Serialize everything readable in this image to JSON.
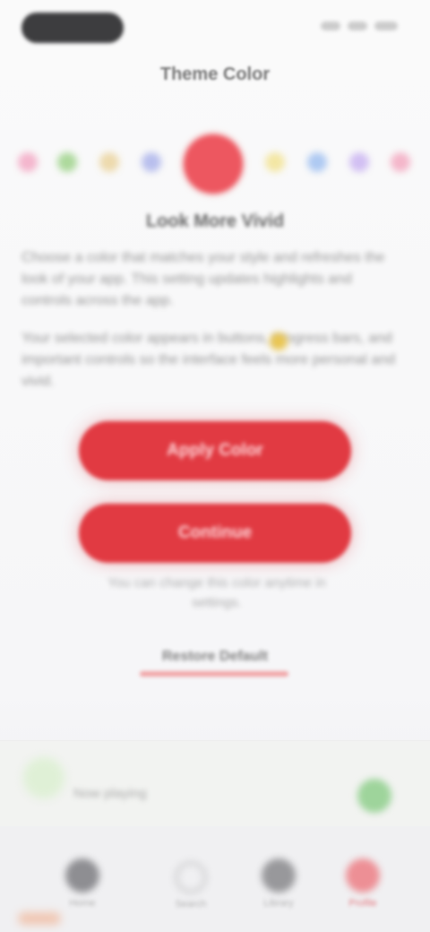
{
  "app": {
    "title": "Theme Color",
    "subtitle": "Look More Vivid"
  },
  "status_bar": {
    "left_indicator": "Dynamic Island",
    "right_icons": [
      "signal-icon",
      "wifi-icon",
      "battery-icon"
    ]
  },
  "colors": {
    "selected": "#ed5760",
    "swatches": [
      {
        "name": "pink",
        "color": "#f3a5c2"
      },
      {
        "name": "green",
        "color": "#9ad185"
      },
      {
        "name": "yellow",
        "color": "#ead29a"
      },
      {
        "name": "blue",
        "color": "#a8b0ea"
      },
      {
        "name": "red",
        "color": "#ed5760"
      },
      {
        "name": "yellow",
        "color": "#f2e28f"
      },
      {
        "name": "sky blue",
        "color": "#9bbdf0"
      },
      {
        "name": "violet",
        "color": "#c8b1f1"
      },
      {
        "name": "rose",
        "color": "#f3a5be"
      }
    ]
  },
  "content": {
    "paragraph_1": "Choose a color that matches your style and refreshes the look of your app. This setting updates highlights and controls across the app.",
    "paragraph_2": "Your selected color appears in buttons, progress bars, and important controls so the interface feels more personal and vivid."
  },
  "buttons": {
    "primary": "Apply Color",
    "secondary": "Continue"
  },
  "caption": "You can change this color anytime in settings.",
  "link": "Restore Default",
  "player": {
    "track": "Now playing",
    "play_icon": "play-icon"
  },
  "tabs": [
    {
      "name": "home",
      "label": "Home",
      "icon": "home-icon"
    },
    {
      "name": "search",
      "label": "Search",
      "icon": "search-icon"
    },
    {
      "name": "library",
      "label": "Library",
      "icon": "library-icon"
    },
    {
      "name": "profile",
      "label": "Profile",
      "icon": "profile-icon"
    }
  ]
}
